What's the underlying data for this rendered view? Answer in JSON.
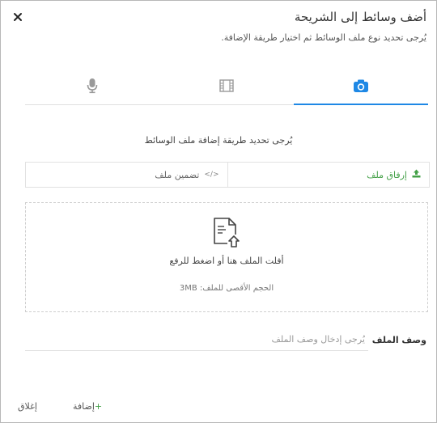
{
  "dialog": {
    "title": "أضف وسائط إلى الشريحة",
    "subtitle": "يُرجى تحديد نوع ملف الوسائط ثم اختيار طريقة الإضافة."
  },
  "tabs": [
    {
      "icon": "camera-icon",
      "active": true
    },
    {
      "icon": "film-icon",
      "active": false
    },
    {
      "icon": "microphone-icon",
      "active": false
    }
  ],
  "method": {
    "prompt": "يُرجى تحديد طريقة إضافة ملف الوسائط",
    "attach_label": "إرفاق ملف",
    "embed_label": "تضمين ملف",
    "embed_code_glyph": "</>"
  },
  "dropzone": {
    "text": "أفلت الملف هنا أو اضغط للرفع",
    "max_size": "الحجم الأقصى للملف: 3MB"
  },
  "description": {
    "label": "وصف الملف",
    "placeholder": "يُرجى إدخال وصف الملف",
    "value": ""
  },
  "footer": {
    "add_label": "إضافة",
    "add_plus": "+",
    "close_label": "إغلاق"
  },
  "colors": {
    "accent": "#1e88e5",
    "success": "#43a047"
  }
}
